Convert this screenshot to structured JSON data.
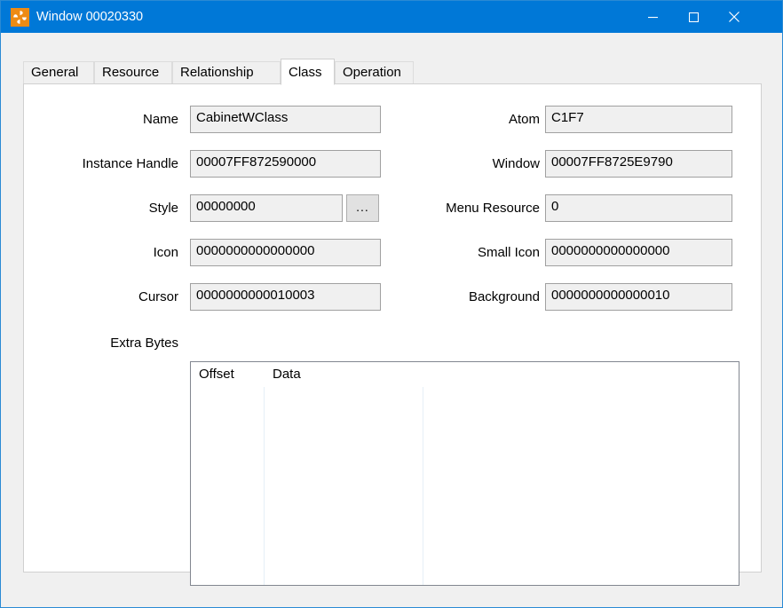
{
  "window": {
    "title": "Window 00020330",
    "icon": "pinwheel-icon",
    "accent_color": "#0078d7",
    "border_color": "#2a8ad4",
    "client_bg": "#f0f0f0",
    "controls": {
      "minimize": "minimize-icon",
      "maximize": "maximize-icon",
      "close": "close-icon"
    }
  },
  "tabs": [
    {
      "label": "General",
      "selected": false
    },
    {
      "label": "Resource",
      "selected": false
    },
    {
      "label": "Relationship",
      "selected": false
    },
    {
      "label": "Class",
      "selected": true
    },
    {
      "label": "Operation",
      "selected": false
    }
  ],
  "fields": {
    "left": [
      {
        "label": "Name",
        "value": "CabinetWClass"
      },
      {
        "label": "Instance Handle",
        "value": "00007FF872590000"
      },
      {
        "label": "Style",
        "value": "00000000"
      },
      {
        "label": "Icon",
        "value": "0000000000000000"
      },
      {
        "label": "Cursor",
        "value": "0000000000010003"
      }
    ],
    "right": [
      {
        "label": "Atom",
        "value": "C1F7"
      },
      {
        "label": "Window",
        "value": "00007FF8725E9790"
      },
      {
        "label": "Menu Resource",
        "value": "0"
      },
      {
        "label": "Small Icon",
        "value": "0000000000000000"
      },
      {
        "label": "Background",
        "value": "0000000000000010"
      }
    ]
  },
  "style_more_button": {
    "label": "..."
  },
  "extra_bytes": {
    "label": "Extra Bytes",
    "columns": [
      "Offset",
      "Data",
      ""
    ],
    "rows": []
  }
}
